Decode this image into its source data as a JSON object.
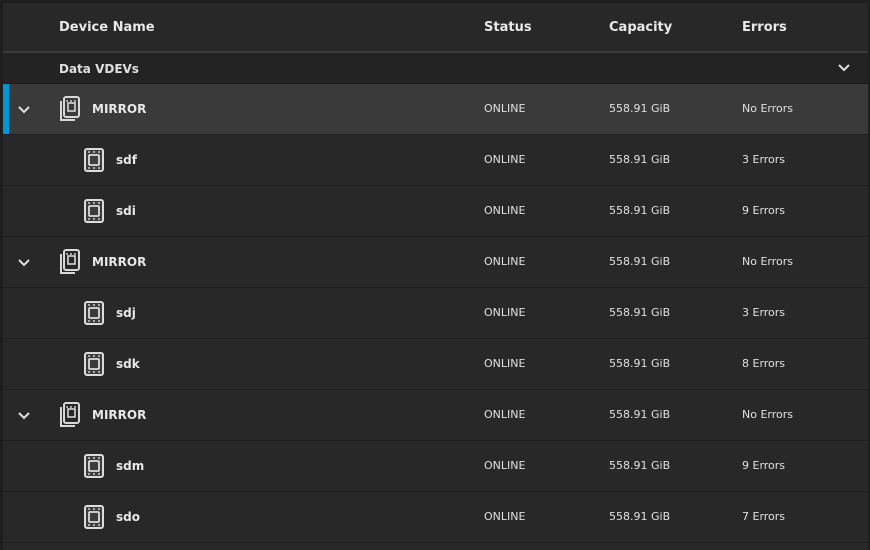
{
  "columns": {
    "name": "Device Name",
    "status": "Status",
    "capacity": "Capacity",
    "errors": "Errors"
  },
  "group": {
    "label": "Data VDEVs",
    "toggle_icon": "chevron-down-icon"
  },
  "colors": {
    "selected_accent": "#0095d5"
  },
  "rows": [
    {
      "kind": "vdev",
      "name": "MIRROR",
      "status": "ONLINE",
      "capacity": "558.91 GiB",
      "errors": "No Errors",
      "selected": true
    },
    {
      "kind": "disk",
      "name": "sdf",
      "status": "ONLINE",
      "capacity": "558.91 GiB",
      "errors": "3 Errors"
    },
    {
      "kind": "disk",
      "name": "sdi",
      "status": "ONLINE",
      "capacity": "558.91 GiB",
      "errors": "9 Errors"
    },
    {
      "kind": "vdev",
      "name": "MIRROR",
      "status": "ONLINE",
      "capacity": "558.91 GiB",
      "errors": "No Errors"
    },
    {
      "kind": "disk",
      "name": "sdj",
      "status": "ONLINE",
      "capacity": "558.91 GiB",
      "errors": "3 Errors"
    },
    {
      "kind": "disk",
      "name": "sdk",
      "status": "ONLINE",
      "capacity": "558.91 GiB",
      "errors": "8 Errors"
    },
    {
      "kind": "vdev",
      "name": "MIRROR",
      "status": "ONLINE",
      "capacity": "558.91 GiB",
      "errors": "No Errors"
    },
    {
      "kind": "disk",
      "name": "sdm",
      "status": "ONLINE",
      "capacity": "558.91 GiB",
      "errors": "9 Errors"
    },
    {
      "kind": "disk",
      "name": "sdo",
      "status": "ONLINE",
      "capacity": "558.91 GiB",
      "errors": "7 Errors"
    }
  ]
}
